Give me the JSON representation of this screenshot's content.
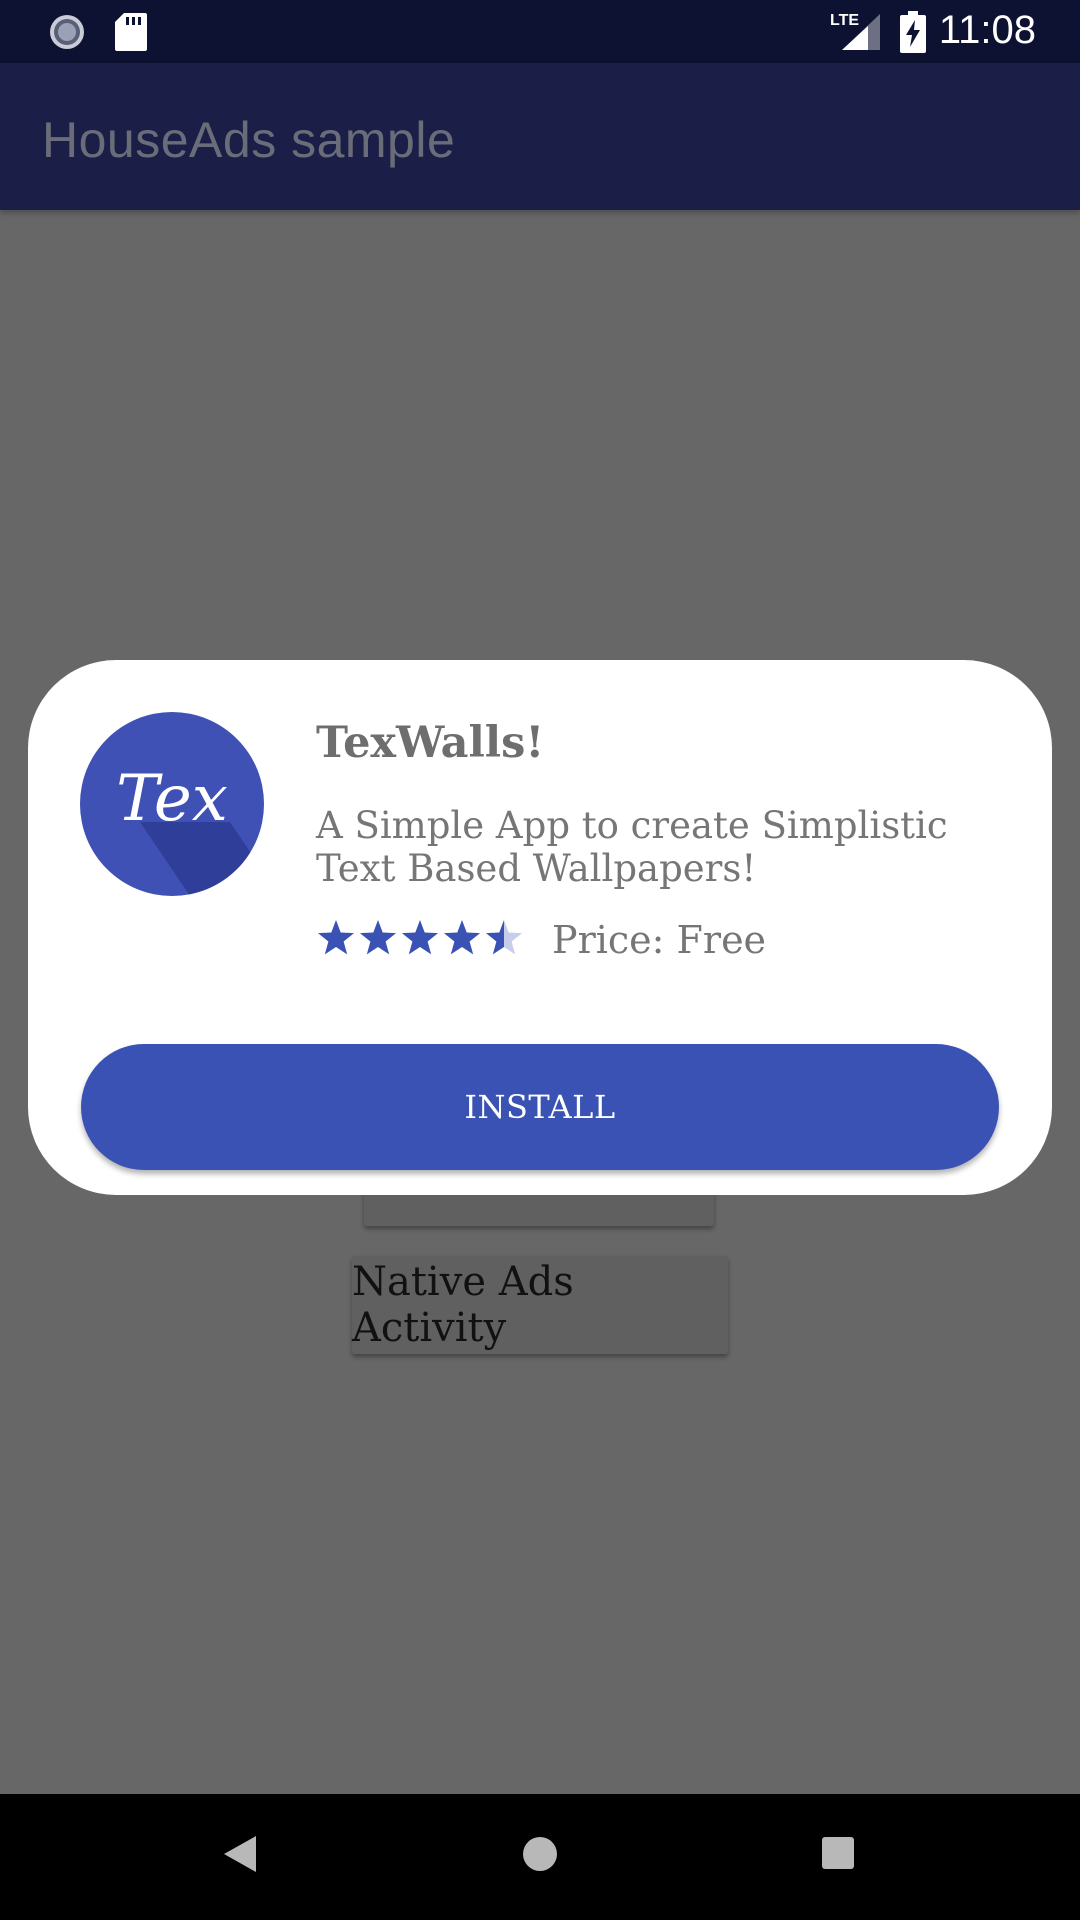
{
  "status_bar": {
    "time": "11:08",
    "network": "LTE",
    "icons": [
      "loading-icon",
      "sd-card-icon",
      "signal-icon",
      "battery-charging-icon"
    ]
  },
  "app_bar": {
    "title": "HouseAds sample"
  },
  "background": {
    "native_ads_button_label": "Native Ads Activity"
  },
  "dialog": {
    "icon_text": "Tex",
    "icon_color": "#3f51b5",
    "title": "TexWalls!",
    "description": "A Simple App to create Simplistic Text Based Wallpapers!",
    "rating": 4.5,
    "rating_max": 5,
    "price_label": "Price: Free",
    "install_label": "INSTALL",
    "accent_color": "#3a52b3"
  },
  "nav_bar": {
    "icons": [
      "back-icon",
      "home-icon",
      "recents-icon"
    ]
  }
}
